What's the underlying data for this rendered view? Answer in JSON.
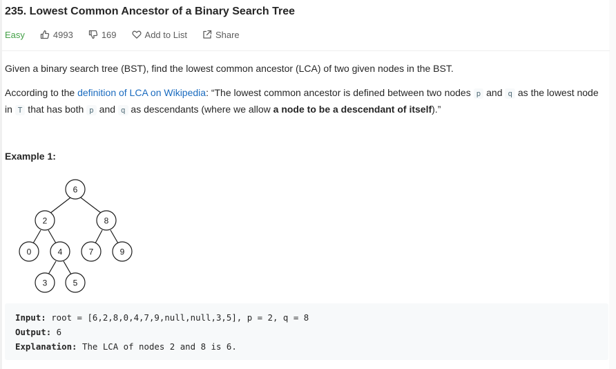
{
  "problem": {
    "title": "235. Lowest Common Ancestor of a Binary Search Tree"
  },
  "meta": {
    "difficulty": "Easy",
    "difficulty_color": "#43a047",
    "likes": "4993",
    "dislikes": "169",
    "add_to_list": "Add to List",
    "share": "Share",
    "icons": [
      "thumbs-up-icon",
      "thumbs-down-icon",
      "heart-icon",
      "share-icon"
    ]
  },
  "description": {
    "p1": "Given a binary search tree (BST), find the lowest common ancestor (LCA) of two given nodes in the BST.",
    "p2_a": "According to the ",
    "p2_link": "definition of LCA on Wikipedia",
    "p2_b": ": “The lowest common ancestor is defined between two nodes ",
    "code_p": "p",
    "and": " and ",
    "code_q": "q",
    "p2_c": " as the lowest node in ",
    "code_T": "T",
    "p2_d": " that has both ",
    "p2_e": " as descendants (where we allow ",
    "p2_bold": "a node to be a descendant of itself",
    "p2_f": ").”"
  },
  "example": {
    "title": "Example 1:",
    "tree_nodes": [
      "6",
      "2",
      "8",
      "0",
      "4",
      "7",
      "9",
      "3",
      "5"
    ],
    "input_label": "Input:",
    "input_value": " root = [6,2,8,0,4,7,9,null,null,3,5], p = 2, q = 8",
    "output_label": "Output:",
    "output_value": " 6",
    "explanation_label": "Explanation:",
    "explanation_value": " The LCA of nodes 2 and 8 is 6."
  }
}
